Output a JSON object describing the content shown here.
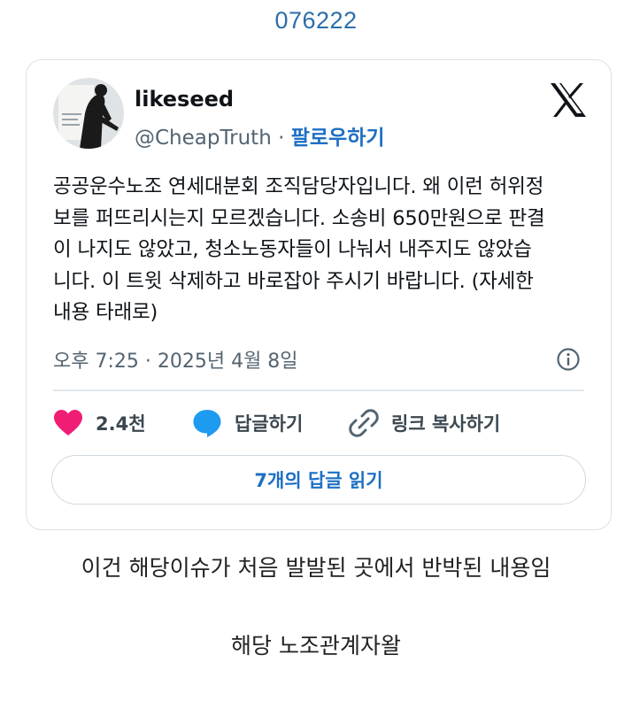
{
  "top_code": "076222",
  "tweet": {
    "display_name": "likeseed",
    "handle": "@CheapTruth",
    "separator": " · ",
    "follow_label": "팔로우하기",
    "body": "공공운수노조 연세대분회 조직담당자입니다. 왜 이런 허위정\n보를 퍼뜨리시는지 모르겠습니다. 소송비 650만원으로 판결\n이 나지도 않았고, 청소노동자들이 나눠서 내주지도 않았습\n니다. 이 트윗 삭제하고 바로잡아 주시기 바랍니다. (자세한\n내용 타래로)",
    "timestamp": "오후 7:25 · 2025년 4월 8일",
    "like_count": "2.4천",
    "reply_label": "답글하기",
    "copy_link_label": "링크 복사하기",
    "read_replies_label": "7개의 답글 읽기"
  },
  "captions": {
    "line1": "이건 해당이슈가 처음 발발된 곳에서 반박된 내용임",
    "line2": "해당 노조관계자왈"
  },
  "colors": {
    "accent": "#1d6fc4",
    "like": "#f01d74",
    "reply": "#1d9bf0",
    "top_code": "#2b6ea8"
  },
  "icons": {
    "logo": "x-logo-icon",
    "info": "info-icon",
    "like": "heart-icon",
    "reply": "speech-bubble-icon",
    "link": "link-icon"
  }
}
